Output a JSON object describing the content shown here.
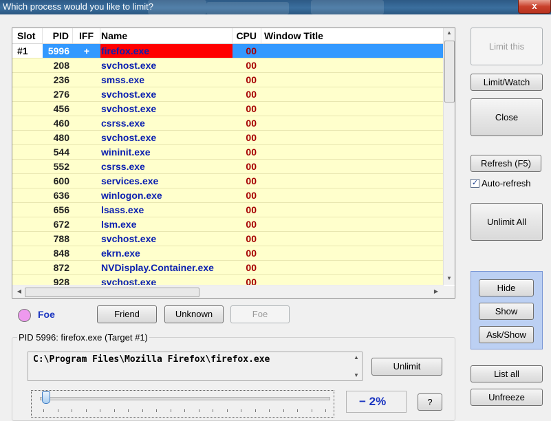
{
  "window": {
    "title": "Which process would you like to limit?",
    "close_glyph": "x"
  },
  "table": {
    "headers": {
      "slot": "Slot",
      "pid": "PID",
      "iff": "IFF",
      "name": "Name",
      "cpu": "CPU",
      "window_title": "Window Title"
    },
    "rows": [
      {
        "slot": "#1",
        "pid": "5996",
        "iff": "+",
        "name": "firefox.exe",
        "cpu": "00",
        "window_title": "",
        "selected": true
      },
      {
        "slot": "",
        "pid": "208",
        "iff": "",
        "name": "svchost.exe",
        "cpu": "00",
        "window_title": ""
      },
      {
        "slot": "",
        "pid": "236",
        "iff": "",
        "name": "smss.exe",
        "cpu": "00",
        "window_title": ""
      },
      {
        "slot": "",
        "pid": "276",
        "iff": "",
        "name": "svchost.exe",
        "cpu": "00",
        "window_title": ""
      },
      {
        "slot": "",
        "pid": "456",
        "iff": "",
        "name": "svchost.exe",
        "cpu": "00",
        "window_title": ""
      },
      {
        "slot": "",
        "pid": "460",
        "iff": "",
        "name": "csrss.exe",
        "cpu": "00",
        "window_title": ""
      },
      {
        "slot": "",
        "pid": "480",
        "iff": "",
        "name": "svchost.exe",
        "cpu": "00",
        "window_title": ""
      },
      {
        "slot": "",
        "pid": "544",
        "iff": "",
        "name": "wininit.exe",
        "cpu": "00",
        "window_title": ""
      },
      {
        "slot": "",
        "pid": "552",
        "iff": "",
        "name": "csrss.exe",
        "cpu": "00",
        "window_title": ""
      },
      {
        "slot": "",
        "pid": "600",
        "iff": "",
        "name": "services.exe",
        "cpu": "00",
        "window_title": ""
      },
      {
        "slot": "",
        "pid": "636",
        "iff": "",
        "name": "winlogon.exe",
        "cpu": "00",
        "window_title": ""
      },
      {
        "slot": "",
        "pid": "656",
        "iff": "",
        "name": "lsass.exe",
        "cpu": "00",
        "window_title": ""
      },
      {
        "slot": "",
        "pid": "672",
        "iff": "",
        "name": "lsm.exe",
        "cpu": "00",
        "window_title": ""
      },
      {
        "slot": "",
        "pid": "788",
        "iff": "",
        "name": "svchost.exe",
        "cpu": "00",
        "window_title": ""
      },
      {
        "slot": "",
        "pid": "848",
        "iff": "",
        "name": "ekrn.exe",
        "cpu": "00",
        "window_title": ""
      },
      {
        "slot": "",
        "pid": "872",
        "iff": "",
        "name": "NVDisplay.Container.exe",
        "cpu": "00",
        "window_title": ""
      },
      {
        "slot": "",
        "pid": "928",
        "iff": "",
        "name": "svchost.exe",
        "cpu": "00",
        "window_title": ""
      }
    ]
  },
  "iff": {
    "status_label": "Foe",
    "status_color": "#ee99ee",
    "friend_button": "Friend",
    "unknown_button": "Unknown",
    "foe_button": "Foe"
  },
  "target": {
    "group_title": "PID 5996: firefox.exe (Target #1)",
    "path": "C:\\Program Files\\Mozilla Firefox\\firefox.exe",
    "unlimit_button": "Unlimit",
    "limit_percent_text": "− 2%",
    "limit_percent": 2,
    "help_button": "?"
  },
  "sidebar": {
    "limit_this": "Limit this",
    "limit_watch": "Limit/Watch",
    "close": "Close",
    "refresh": "Refresh (F5)",
    "auto_refresh_label": "Auto-refresh",
    "auto_refresh_checked": true,
    "unlimit_all": "Unlimit All",
    "hide": "Hide",
    "show": "Show",
    "ask_show": "Ask/Show",
    "list_all": "List all",
    "unfreeze": "Unfreeze"
  },
  "colors": {
    "row_bg": "#ffffcc",
    "selection": "#3399ff",
    "selected_name_bg": "#ff0000",
    "process_name": "#0a1fb0",
    "cpu_text": "#a50000"
  }
}
